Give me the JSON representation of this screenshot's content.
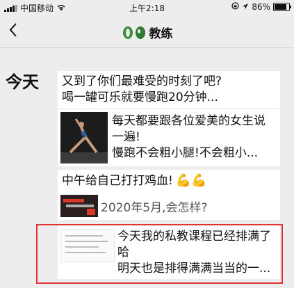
{
  "status_bar": {
    "carrier": "中国移动",
    "time": "上午2:18",
    "battery_percent": "86%",
    "battery_level": 0.86
  },
  "nav": {
    "title": "教练"
  },
  "feed": {
    "day_label": "今天",
    "items": [
      {
        "lines": [
          "又到了你们最难受的时刻了吧?",
          "喝一罐可乐就要慢跑20分钟..."
        ]
      },
      {
        "lines": [
          "每天都要跟各位爱美的女生说",
          "一遍!",
          "慢跑不会粗小腿!不会粗小..."
        ]
      },
      {
        "headline": "中午给自己打打鸡血!",
        "subline": "2020年5月,会怎样?"
      },
      {
        "lines": [
          "今天我的私教课程已经排满了",
          "哈",
          "明天也是排得满满当当的一..."
        ]
      }
    ]
  },
  "colors": {
    "background": "#ededed",
    "highlight": "#e0333a",
    "card": "#ffffff"
  }
}
